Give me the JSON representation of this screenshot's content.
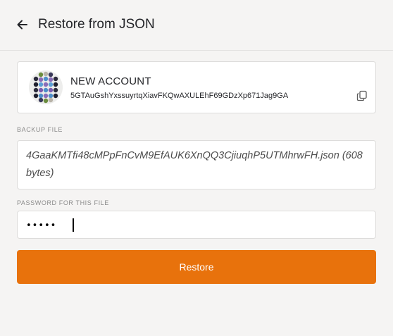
{
  "header": {
    "title": "Restore from JSON",
    "back_icon": "arrow-left-icon"
  },
  "account": {
    "name": "NEW ACCOUNT",
    "address": "5GTAuGshYxssuyrtqXiavFKQwAXULEhF69GDzXp671Jag9GA",
    "copy_icon": "copy-icon"
  },
  "backup_file": {
    "label": "BACKUP FILE",
    "value": "4GaaKMTfi48cMPpFnCvM9EfAUK6XnQQ3CjiuqhP5UTMhrwFH.json (608 bytes)"
  },
  "password": {
    "label": "PASSWORD FOR THIS FILE",
    "value": "•••••"
  },
  "restore_button": {
    "label": "Restore",
    "color": "#e8720c"
  }
}
